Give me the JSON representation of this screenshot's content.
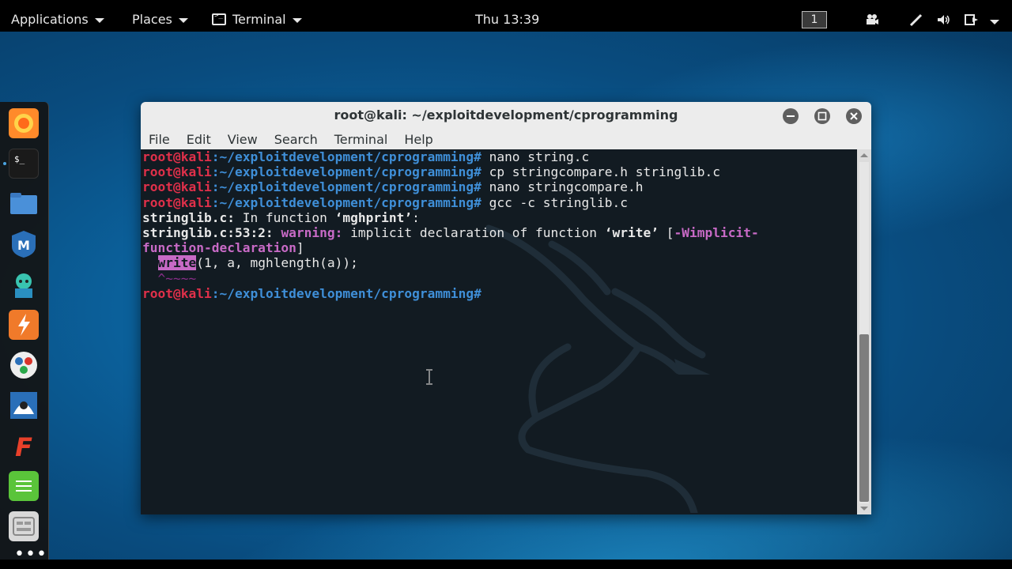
{
  "topbar": {
    "applications": "Applications",
    "places": "Places",
    "terminal_menu": "Terminal",
    "clock": "Thu 13:39",
    "workspace": "1"
  },
  "window": {
    "title": "root@kali: ~/exploitdevelopment/cprogramming",
    "menu": [
      "File",
      "Edit",
      "View",
      "Search",
      "Terminal",
      "Help"
    ]
  },
  "terminal": {
    "prompt_user": "root@kali",
    "prompt_path": ":~/exploitdevelopment/cprogramming",
    "prompt_symbol": "#",
    "commands": [
      " nano string.c",
      " cp stringcompare.h stringlib.c",
      " nano stringcompare.h",
      " gcc -c stringlib.c"
    ],
    "out_line1_a": "stringlib.c:",
    "out_line1_b": " In function ",
    "out_line1_c": "‘mghprint’",
    "out_line1_d": ":",
    "out_line2_a": "stringlib.c:53:2:",
    "out_line2_b": "warning:",
    "out_line2_c": " implicit declaration of function ",
    "out_line2_d": "‘write’",
    "out_line2_e": " [",
    "out_line2_f": "-Wimplicit-",
    "out_line3_a": "function-declaration",
    "out_line3_b": "]",
    "code_indent": "  ",
    "code_hl": "write",
    "code_rest": "(1, a, mghlength(a));",
    "caret_line": "  ^~~~~"
  },
  "dock": {
    "items": [
      "firefox-icon",
      "terminal-icon",
      "files-icon",
      "metasploit-icon",
      "armitage-icon",
      "burpsuite-icon",
      "maltego-icon",
      "beef-icon",
      "faraday-icon",
      "leafpad-icon",
      "cherrytree-icon",
      "show-apps-icon"
    ]
  }
}
